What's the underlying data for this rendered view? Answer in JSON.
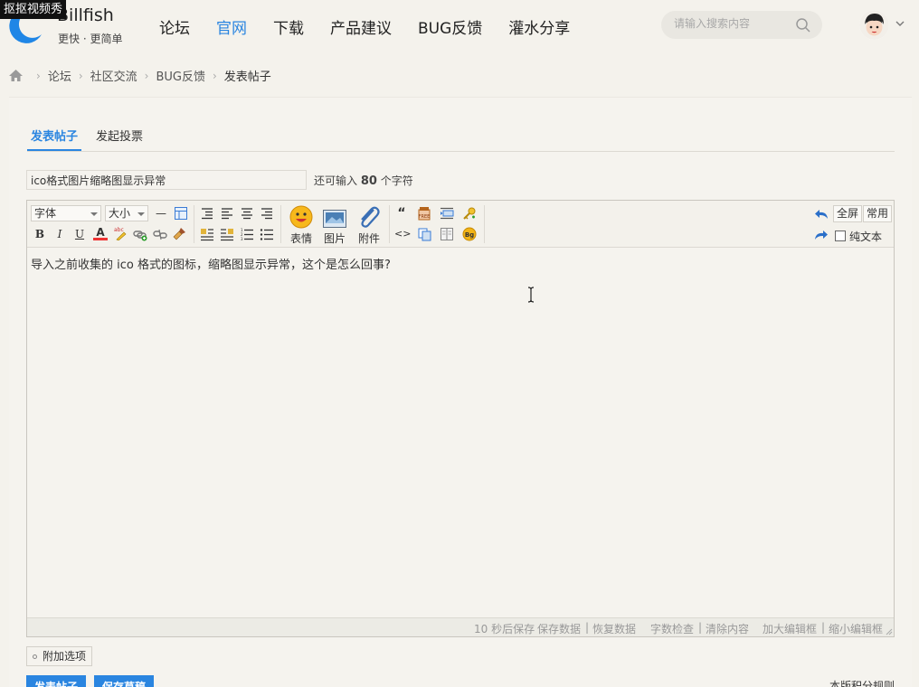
{
  "watermark": "抠抠视频秀",
  "brand": {
    "name": "Billfish",
    "slogan": "更快 · 更简单",
    "accent": "#2a85e0"
  },
  "nav": [
    {
      "label": "论坛",
      "active": false
    },
    {
      "label": "官网",
      "active": true
    },
    {
      "label": "下载",
      "active": false
    },
    {
      "label": "产品建议",
      "active": false
    },
    {
      "label": "BUG反馈",
      "active": false
    },
    {
      "label": "灌水分享",
      "active": false
    }
  ],
  "search": {
    "placeholder": "请输入搜索内容",
    "icon": "search-icon"
  },
  "breadcrumb": {
    "items": [
      "论坛",
      "社区交流",
      "BUG反馈"
    ],
    "current": "发表帖子"
  },
  "tabs": [
    {
      "label": "发表帖子",
      "active": true
    },
    {
      "label": "发起投票",
      "active": false
    }
  ],
  "post": {
    "title_value": "ico格式图片缩略图显示异常",
    "hint_prefix": "还可输入",
    "hint_count": "80",
    "hint_suffix": "个字符",
    "body": "导入之前收集的 ico 格式的图标，缩略图显示异常，这个是怎么回事?"
  },
  "toolbar": {
    "font_label": "字体",
    "size_label": "大小",
    "emoji_label": "表情",
    "image_label": "图片",
    "attach_label": "附件",
    "fullscreen_label": "全屏",
    "common_label": "常用",
    "plaintext_label": "纯文本",
    "bold": "B",
    "italic": "I",
    "underline": "U",
    "fontcolor": "A",
    "quote": "“",
    "code": "<>",
    "hr": "—"
  },
  "statusbar": {
    "autosave": "10 秒后保存",
    "save_data": "保存数据",
    "restore_data": "恢复数据",
    "word_check": "字数检查",
    "clear_content": "清除内容",
    "enlarge": "加大编辑框",
    "shrink": "缩小编辑框",
    "sep": "|"
  },
  "extra_options": "附加选项",
  "buttons": {
    "submit": "发表帖子",
    "save_draft": "保存草稿"
  },
  "rules_link": "本版积分规则"
}
